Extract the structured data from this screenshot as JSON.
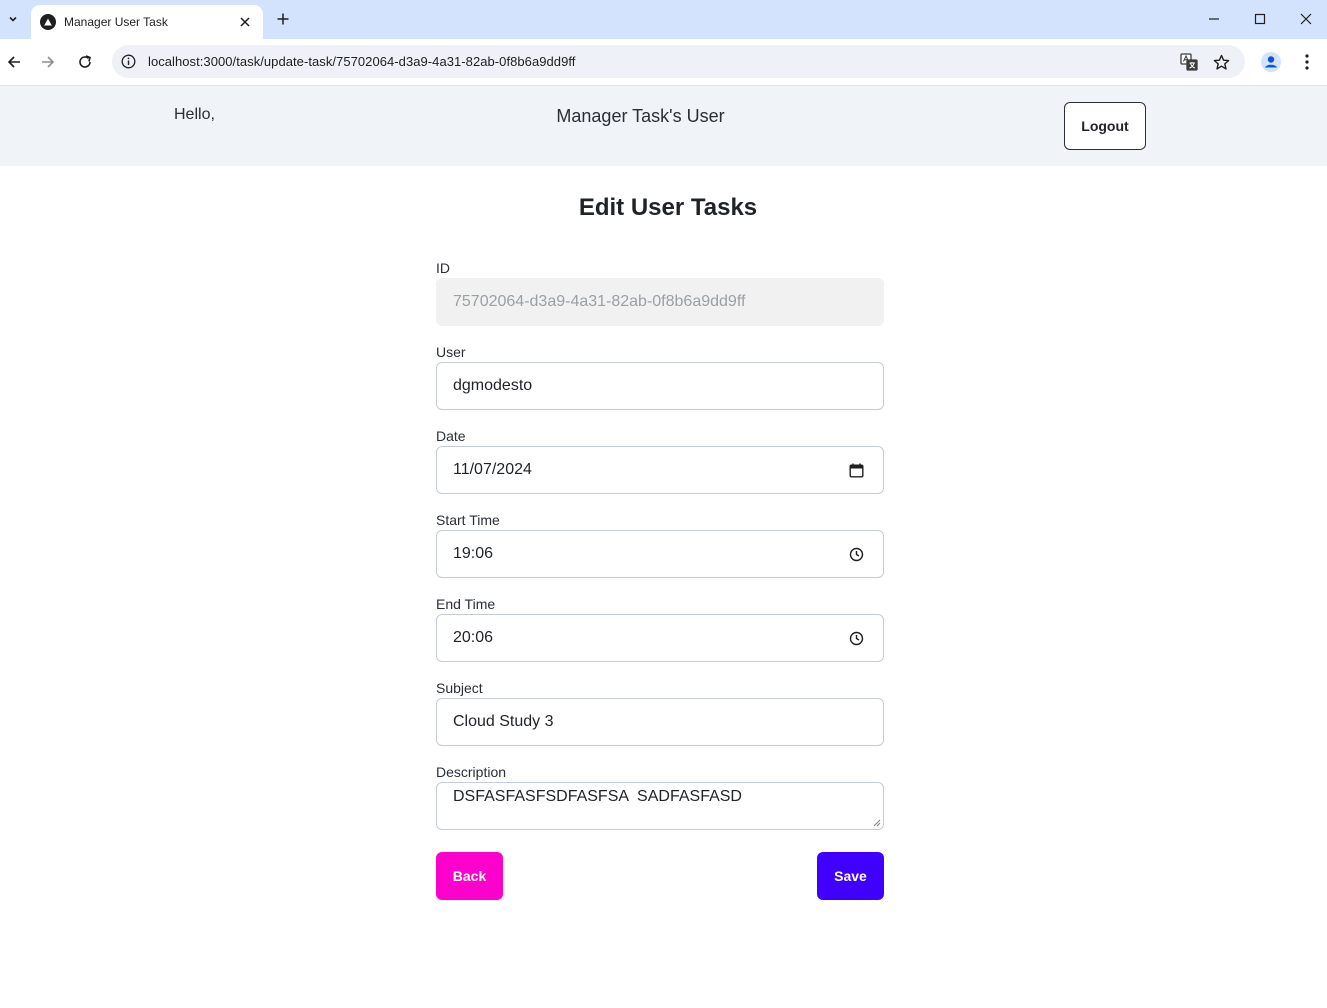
{
  "browser": {
    "tab_title": "Manager User Task",
    "url": "localhost:3000/task/update-task/75702064-d3a9-4a31-82ab-0f8b6a9dd9ff"
  },
  "header": {
    "greeting": "Hello,",
    "title": "Manager Task's User",
    "logout_label": "Logout"
  },
  "form": {
    "title": "Edit User Tasks",
    "fields": {
      "id": {
        "label": "ID",
        "value": "75702064-d3a9-4a31-82ab-0f8b6a9dd9ff"
      },
      "user": {
        "label": "User",
        "value": "dgmodesto"
      },
      "date": {
        "label": "Date",
        "value": "11/07/2024"
      },
      "start_time": {
        "label": "Start Time",
        "value": "19:06"
      },
      "end_time": {
        "label": "End Time",
        "value": "20:06"
      },
      "subject": {
        "label": "Subject",
        "value": "Cloud Study 3"
      },
      "description": {
        "label": "Description",
        "value": "DSFASFASFSDFASFSA  SADFASFASD"
      }
    },
    "back_label": "Back",
    "save_label": "Save"
  },
  "colors": {
    "back_button": "#ff00cc",
    "save_button": "#4000ff",
    "header_bg": "#f0f3f8",
    "tabbar_bg": "#d3e3fd"
  }
}
